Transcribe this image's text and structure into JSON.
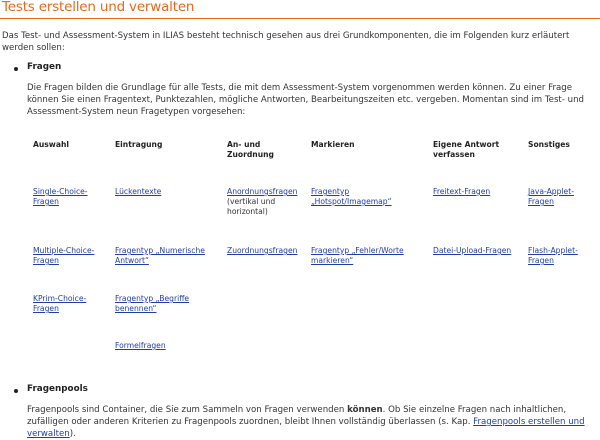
{
  "page": {
    "title": "Tests erstellen und verwalten",
    "intro": "Das Test- und Assessment-System in ILIAS besteht technisch gesehen aus drei Grundkomponenten, die im Folgenden kurz erläutert werden sollen:"
  },
  "sections": {
    "fragen": {
      "title": "Fragen",
      "text": "Die Fragen bilden die Grundlage für alle Tests, die mit dem Assessment-System vorgenommen werden können. Zu einer Frage können Sie einen Fragentext, Punktezahlen, mögliche Antworten, Bearbeitungszeiten etc. vergeben. Momentan sind im Test- und Assessment-System neun Fragetypen vorgesehen:"
    },
    "fragenpools": {
      "title": "Fragenpools",
      "text_before": "Fragenpools sind Container, die Sie zum Sammeln von Fragen verwenden ",
      "text_bold": "können",
      "text_after": ". Ob Sie einzelne Fragen nach inhaltlichen, zufälligen oder anderen Kriterien zu Fragenpools zuordnen, bleibt Ihnen vollständig überlassen (s. Kap. ",
      "link": "Fragenpools erstellen und verwalten",
      "text_end": ")."
    }
  },
  "table": {
    "headers": {
      "auswahl": "Auswahl",
      "eintragung": "Eintragung",
      "zuordnung_1": "An- und",
      "zuordnung_2": "Zuordnung",
      "markieren": "Markieren",
      "eigene_1": "Eigene Antwort",
      "eigene_2": "verfassen",
      "sonstiges": "Sonstiges"
    },
    "row1": {
      "auswahl_1": "Single-Choice-",
      "auswahl_2": "Fragen",
      "eintragung": "Lückentexte",
      "zuordnung": "Anordnungsfragen",
      "zuordnung_note_1": "(vertikal und",
      "zuordnung_note_2": "horizontal)",
      "markieren_1": "Fragentyp",
      "markieren_2": "„Hotspot/Imagemap“",
      "eigene": "Freitext-Fragen",
      "sonstiges_1": "Java-Applet-",
      "sonstiges_2": "Fragen"
    },
    "row2": {
      "auswahl_1": "Multiple-Choice-",
      "auswahl_2": "Fragen",
      "eintragung_1": "Fragentyp „Numerische",
      "eintragung_2": "Antwort“",
      "zuordnung": "Zuordnungsfragen",
      "markieren_1": "Fragentyp „Fehler/Worte",
      "markieren_2": "markieren“",
      "eigene": "Datei-Upload-Fragen",
      "sonstiges_1": "Flash-Applet-",
      "sonstiges_2": "Fragen"
    },
    "row3": {
      "auswahl_1": "KPrim-Choice-",
      "auswahl_2": "Fragen",
      "eintragung_1": "Fragentyp „Begriffe",
      "eintragung_2": "benennen“"
    },
    "row4": {
      "eintragung": "Formelfragen"
    }
  }
}
